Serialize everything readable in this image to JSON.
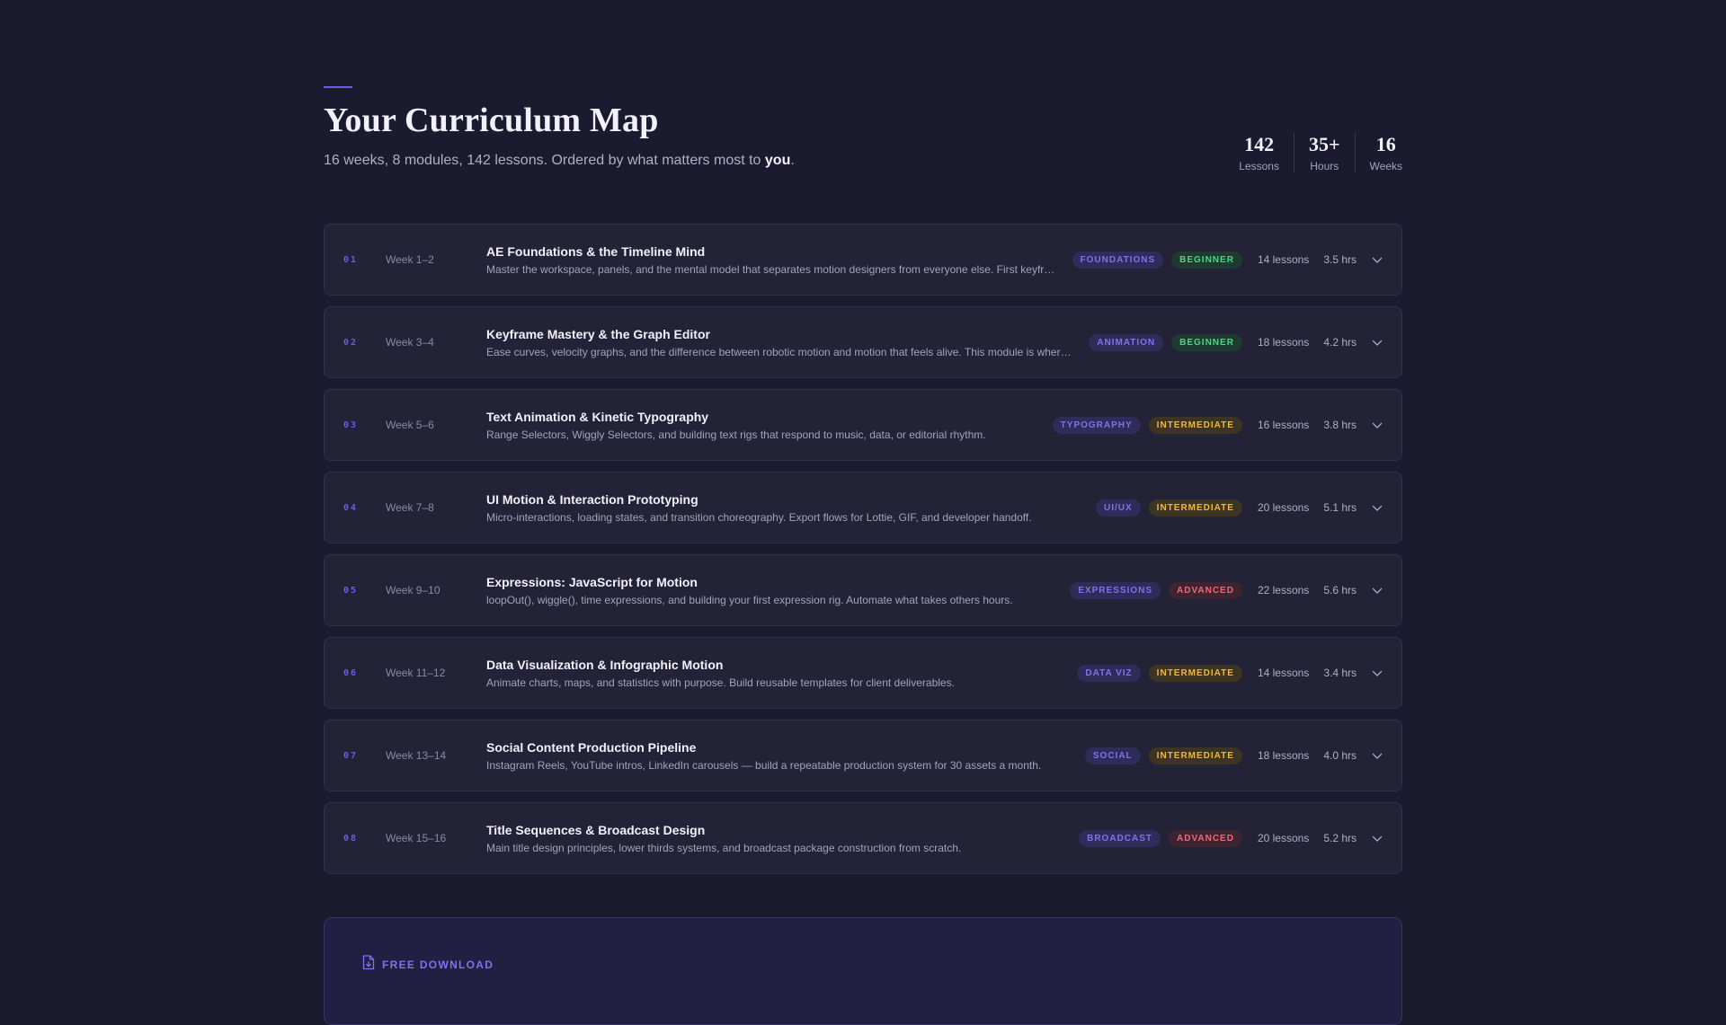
{
  "header": {
    "title": "Your Curriculum Map",
    "subtitle_prefix": "16 weeks, 8 modules, 142 lessons. Ordered by what matters most to ",
    "subtitle_emphasis": "you",
    "subtitle_suffix": "."
  },
  "stats": [
    {
      "value": "142",
      "label": "Lessons"
    },
    {
      "value": "35+",
      "label": "Hours"
    },
    {
      "value": "16",
      "label": "Weeks"
    }
  ],
  "modules": [
    {
      "number": "01",
      "weeks": "Week 1–2",
      "title": "AE Foundations & the Timeline Mind",
      "description": "Master the workspace, panels, and the mental model that separates motion designers from everyone else. First keyfr…",
      "category": "FOUNDATIONS",
      "level": "BEGINNER",
      "lessons": "14 lessons",
      "hours": "3.5 hrs"
    },
    {
      "number": "02",
      "weeks": "Week 3–4",
      "title": "Keyframe Mastery & the Graph Editor",
      "description": "Ease curves, velocity graphs, and the difference between robotic motion and motion that feels alive. This module is wher…",
      "category": "ANIMATION",
      "level": "BEGINNER",
      "lessons": "18 lessons",
      "hours": "4.2 hrs"
    },
    {
      "number": "03",
      "weeks": "Week 5–6",
      "title": "Text Animation & Kinetic Typography",
      "description": "Range Selectors, Wiggly Selectors, and building text rigs that respond to music, data, or editorial rhythm.",
      "category": "TYPOGRAPHY",
      "level": "INTERMEDIATE",
      "lessons": "16 lessons",
      "hours": "3.8 hrs"
    },
    {
      "number": "04",
      "weeks": "Week 7–8",
      "title": "UI Motion & Interaction Prototyping",
      "description": "Micro-interactions, loading states, and transition choreography. Export flows for Lottie, GIF, and developer handoff.",
      "category": "UI/UX",
      "level": "INTERMEDIATE",
      "lessons": "20 lessons",
      "hours": "5.1 hrs"
    },
    {
      "number": "05",
      "weeks": "Week 9–10",
      "title": "Expressions: JavaScript for Motion",
      "description": "loopOut(), wiggle(), time expressions, and building your first expression rig. Automate what takes others hours.",
      "category": "EXPRESSIONS",
      "level": "ADVANCED",
      "lessons": "22 lessons",
      "hours": "5.6 hrs"
    },
    {
      "number": "06",
      "weeks": "Week 11–12",
      "title": "Data Visualization & Infographic Motion",
      "description": "Animate charts, maps, and statistics with purpose. Build reusable templates for client deliverables.",
      "category": "DATA VIZ",
      "level": "INTERMEDIATE",
      "lessons": "14 lessons",
      "hours": "3.4 hrs"
    },
    {
      "number": "07",
      "weeks": "Week 13–14",
      "title": "Social Content Production Pipeline",
      "description": "Instagram Reels, YouTube intros, LinkedIn carousels — build a repeatable production system for 30 assets a month.",
      "category": "SOCIAL",
      "level": "INTERMEDIATE",
      "lessons": "18 lessons",
      "hours": "4.0 hrs"
    },
    {
      "number": "08",
      "weeks": "Week 15–16",
      "title": "Title Sequences & Broadcast Design",
      "description": "Main title design principles, lower thirds systems, and broadcast package construction from scratch.",
      "category": "BROADCAST",
      "level": "ADVANCED",
      "lessons": "20 lessons",
      "hours": "5.2 hrs"
    }
  ],
  "download": {
    "label": "FREE DOWNLOAD",
    "icon": "file-download-icon"
  },
  "colors": {
    "background": "#1b1a2e",
    "card": "#232236",
    "accent": "#6b5ce7",
    "beginner": "#4fd38a",
    "intermediate": "#f0b63e",
    "advanced": "#ee6a7a"
  }
}
